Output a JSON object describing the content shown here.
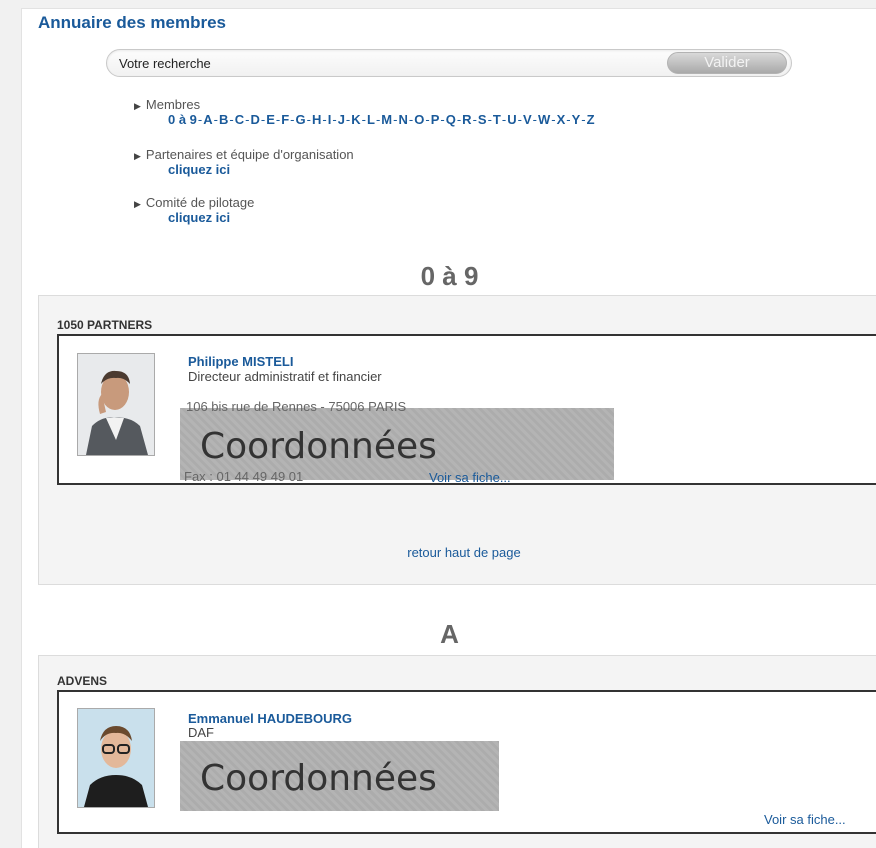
{
  "page": {
    "title": "Annuaire des membres"
  },
  "search": {
    "placeholder": "Votre recherche",
    "submit_label": "Valider"
  },
  "nav": {
    "members_label": "Membres",
    "letters": [
      "0 à 9",
      "A",
      "B",
      "C",
      "D",
      "E",
      "F",
      "G",
      "H",
      "I",
      "J",
      "K",
      "L",
      "M",
      "N",
      "O",
      "P",
      "Q",
      "R",
      "S",
      "T",
      "U",
      "V",
      "W",
      "X",
      "Y",
      "Z"
    ],
    "partners_label": "Partenaires et équipe d'organisation",
    "partners_link": "cliquez ici",
    "committee_label": "Comité de pilotage",
    "committee_link": "cliquez ici"
  },
  "sections": [
    {
      "heading": "0 à 9",
      "company": "1050 PARTNERS",
      "person_name": "Philippe MISTELI",
      "person_role": "Directeur administratif et financier",
      "partial_address": "106 bis rue de Rennes - 75006 PARIS",
      "partial_fax": "Fax : 01 44 49 49 01",
      "redacted_label": "Coordonnées",
      "view_link": "Voir sa fiche...",
      "back_to_top": "retour haut de page"
    },
    {
      "heading": "A",
      "company": "ADVENS",
      "person_name": "Emmanuel HAUDEBOURG",
      "person_role": "DAF",
      "redacted_label": "Coordonnées",
      "view_link": "Voir sa fiche..."
    }
  ]
}
